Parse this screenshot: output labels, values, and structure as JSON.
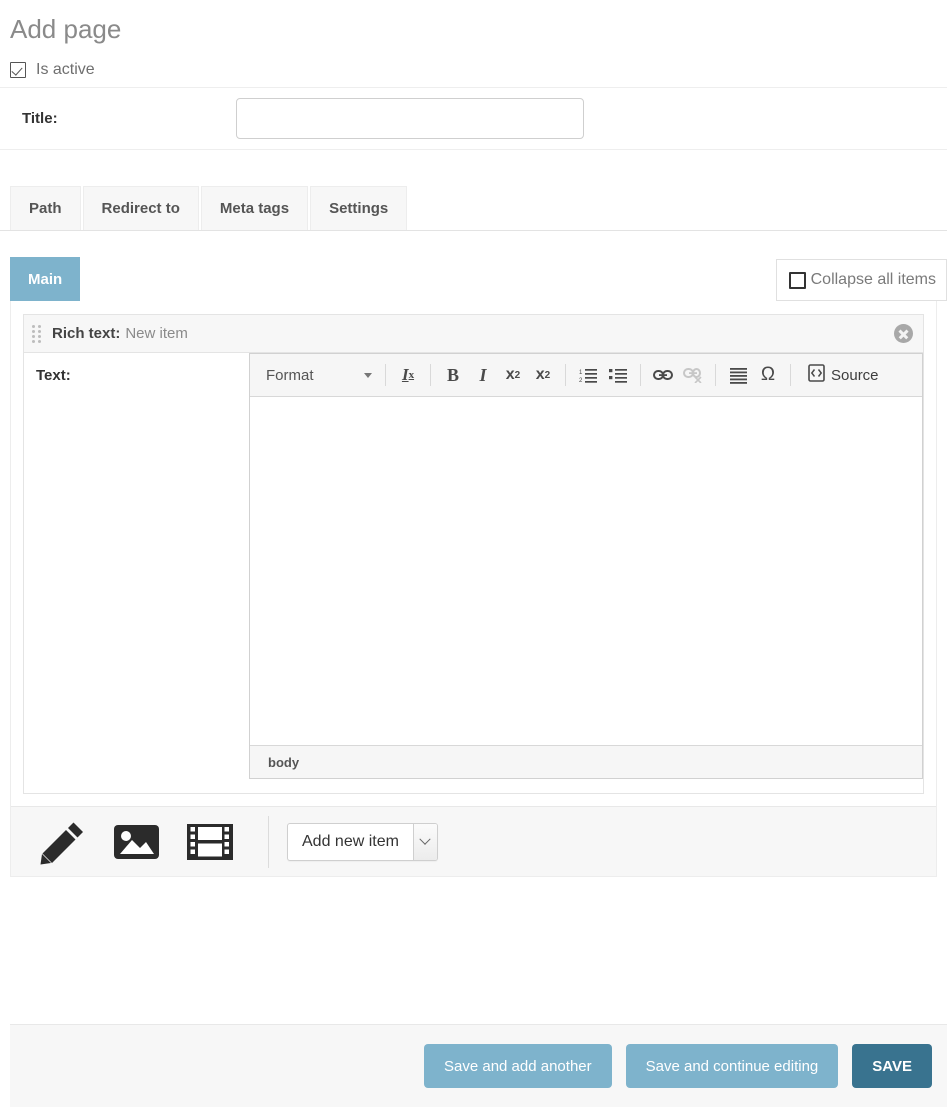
{
  "header": {
    "title": "Add page"
  },
  "fields": {
    "is_active": {
      "label": "Is active",
      "checked": true
    },
    "title": {
      "label": "Title:",
      "value": "",
      "placeholder": ""
    }
  },
  "tabs": [
    {
      "label": "Path"
    },
    {
      "label": "Redirect to"
    },
    {
      "label": "Meta tags"
    },
    {
      "label": "Settings"
    }
  ],
  "content_panel": {
    "active_tab": "Main",
    "collapse_all": {
      "label": "Collapse all items",
      "checked": false
    },
    "item": {
      "type_label": "Rich text:",
      "name": "New item",
      "remove_icon": "remove-circle-icon",
      "drag_icon": "drag-handle-icon",
      "field_label": "Text:"
    }
  },
  "editor": {
    "format_combo": {
      "label": "Format"
    },
    "buttons": [
      {
        "name": "remove-format-icon",
        "label": "Remove Format"
      },
      {
        "name": "bold-icon",
        "label": "Bold"
      },
      {
        "name": "italic-icon",
        "label": "Italic"
      },
      {
        "name": "subscript-icon",
        "label": "Subscript"
      },
      {
        "name": "superscript-icon",
        "label": "Superscript"
      },
      {
        "name": "numbered-list-icon",
        "label": "Insert/Remove Numbered List"
      },
      {
        "name": "bulleted-list-icon",
        "label": "Insert/Remove Bulleted List"
      },
      {
        "name": "link-icon",
        "label": "Link"
      },
      {
        "name": "unlink-icon",
        "label": "Unlink"
      },
      {
        "name": "justify-icon",
        "label": "Justify"
      },
      {
        "name": "special-char-icon",
        "label": "Insert Special Character"
      },
      {
        "name": "source-icon",
        "label": "Source"
      }
    ],
    "source_label": "Source",
    "content": "",
    "status_path": "body"
  },
  "add_bar": {
    "icons": [
      {
        "name": "pencil-icon",
        "label": "Add rich text"
      },
      {
        "name": "image-icon",
        "label": "Add image"
      },
      {
        "name": "video-icon",
        "label": "Add video"
      }
    ],
    "select": {
      "value": "Add new item",
      "options": [
        "Add new item"
      ]
    }
  },
  "footer": {
    "save_add_another": "Save and add another",
    "save_continue": "Save and continue editing",
    "save": "SAVE"
  },
  "colors": {
    "accent_light": "#7eb3cc",
    "accent_dark": "#39738f",
    "title_gray": "#8a8a8a"
  }
}
